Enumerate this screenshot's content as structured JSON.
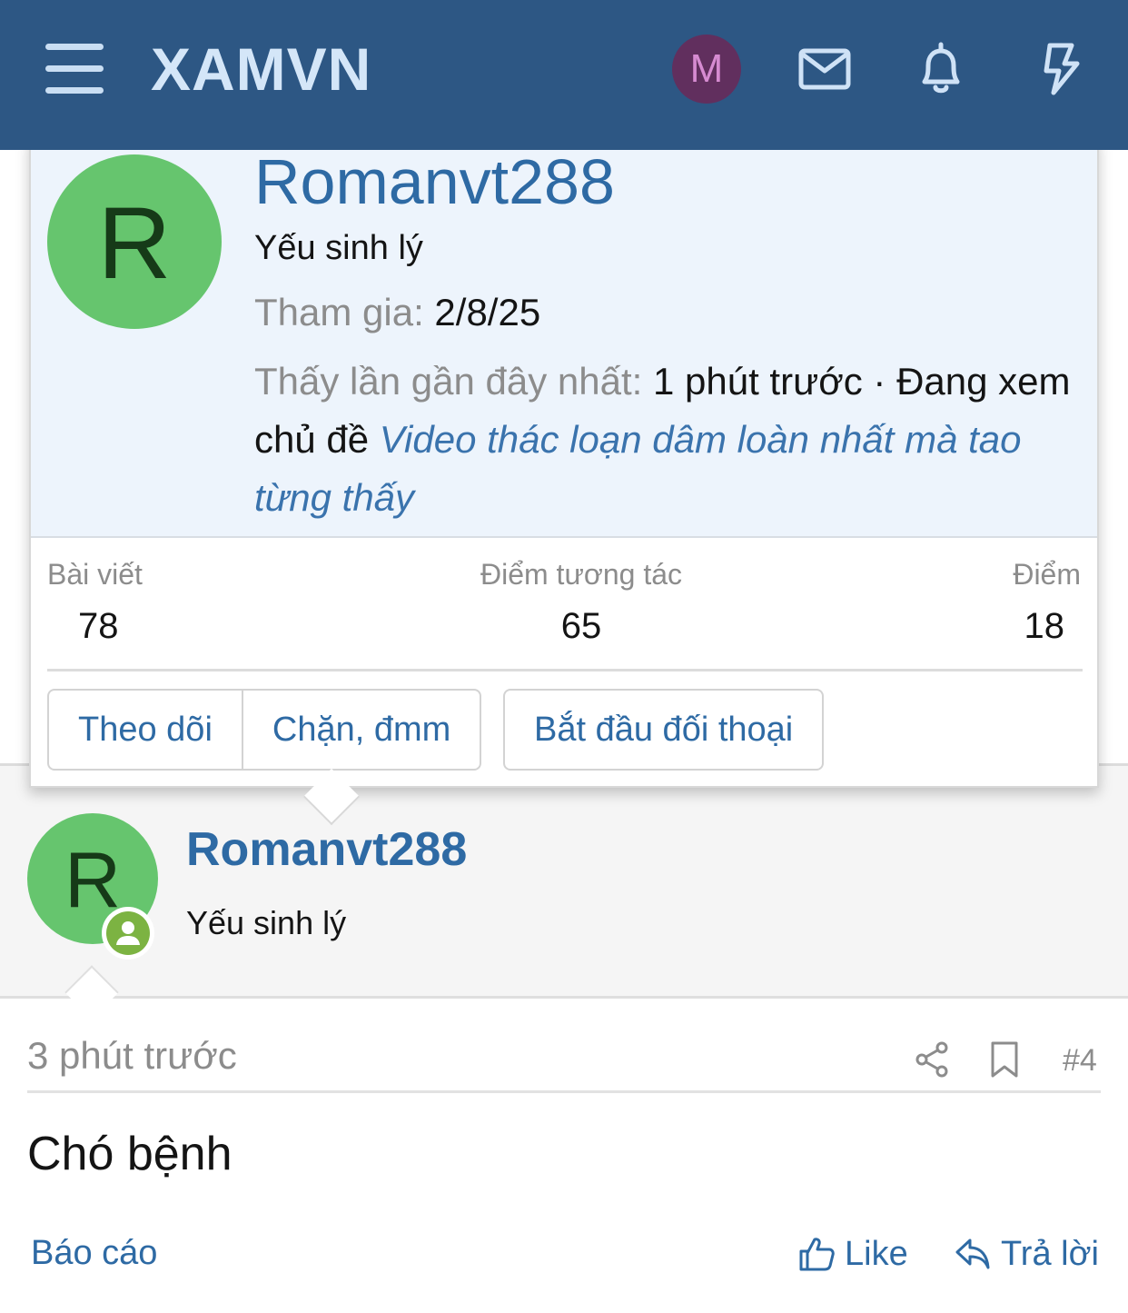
{
  "header": {
    "brand": "XAMVN",
    "avatar_letter": "M",
    "icons": [
      "menu-icon",
      "envelope-icon",
      "bell-icon",
      "lightning-icon"
    ]
  },
  "member_card": {
    "avatar_letter": "R",
    "username": "Romanvt288",
    "user_title": "Yếu sinh lý",
    "joined_label": "Tham gia:",
    "joined_value": "2/8/25",
    "last_seen_label": "Thấy lần gần đây nhất:",
    "last_seen_value": "1 phút trước · Đang xem chủ đề",
    "last_seen_thread": "Video thác loạn dâm loàn nhất mà tao từng thấy",
    "stats": {
      "posts_label": "Bài viết",
      "posts_value": "78",
      "reaction_label": "Điểm tương tác",
      "reaction_value": "65",
      "points_label": "Điểm",
      "points_value": "18"
    },
    "buttons": {
      "follow": "Theo dõi",
      "ignore": "Chặn, đmm",
      "conversation": "Bắt đầu đối thoại"
    }
  },
  "post": {
    "avatar_letter": "R",
    "username": "Romanvt288",
    "user_title": "Yếu sinh lý",
    "time": "3 phút trước",
    "number": "#4",
    "content": "Chó bệnh",
    "report": "Báo cáo",
    "like": "Like",
    "reply": "Trả lời"
  },
  "colors": {
    "header_bg": "#2d5784",
    "link": "#2e6aa4",
    "avatar_r": "#66c56e",
    "avatar_m": "#612f5e",
    "online": "#7cb342"
  }
}
